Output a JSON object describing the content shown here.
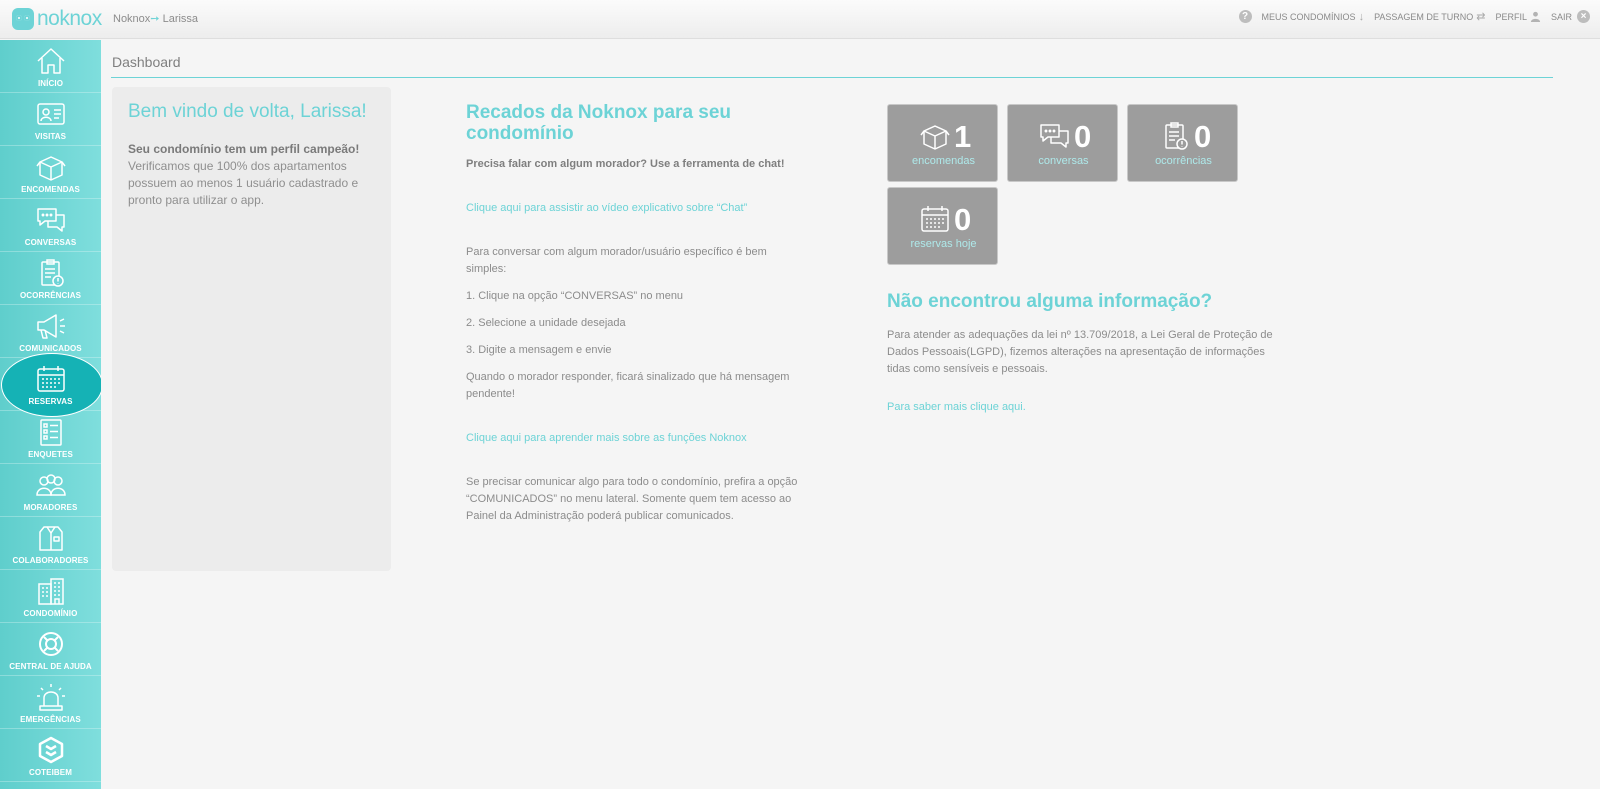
{
  "app": {
    "logo_text": "noknox"
  },
  "breadcrumb": {
    "root": "Noknox",
    "arrow": "➙",
    "current": "Larissa"
  },
  "topnav": {
    "help_icon": "question-circle-icon",
    "meus_condominios": "MEUS CONDOMÍNIOS",
    "passagem_de_turno": "PASSAGEM DE TURNO",
    "perfil": "PERFIL",
    "sair": "SAIR"
  },
  "sidebar": {
    "items": [
      {
        "label": "INÍCIO",
        "icon": "home-icon"
      },
      {
        "label": "VISITAS",
        "icon": "id-card-icon"
      },
      {
        "label": "ENCOMENDAS",
        "icon": "package-icon"
      },
      {
        "label": "CONVERSAS",
        "icon": "chat-icon"
      },
      {
        "label": "OCORRÊNCIAS",
        "icon": "clipboard-alert-icon"
      },
      {
        "label": "COMUNICADOS",
        "icon": "megaphone-icon"
      },
      {
        "label": "RESERVAS",
        "icon": "calendar-icon",
        "active": true
      },
      {
        "label": "ENQUETES",
        "icon": "checklist-icon"
      },
      {
        "label": "MORADORES",
        "icon": "residents-icon"
      },
      {
        "label": "COLABORADORES",
        "icon": "staff-icon"
      },
      {
        "label": "CONDOMÍNIO",
        "icon": "building-icon"
      },
      {
        "label": "CENTRAL DE AJUDA",
        "icon": "lifebuoy-icon"
      },
      {
        "label": "EMERGÊNCIAS",
        "icon": "siren-icon"
      },
      {
        "label": "COTEIBEM",
        "icon": "coteibem-icon"
      }
    ]
  },
  "main": {
    "page_title": "Dashboard",
    "welcome": {
      "title": "Bem vindo de volta, Larissa!",
      "subtitle": "Seu condomínio tem um perfil campeão!",
      "body": "Verificamos que 100% dos apartamentos possuem ao menos 1 usuário cadastrado e pronto para utilizar o app."
    },
    "messages": {
      "title": "Recados da Noknox para seu condomínio",
      "intro": "Precisa falar com algum morador? Use a ferramenta de chat!",
      "video_link": "Clique aqui para assistir ao vídeo explicativo sobre “Chat”",
      "para1": "Para conversar com algum morador/usuário específico é bem simples:",
      "step1": "1. Clique na opção “CONVERSAS” no menu",
      "step2": "2. Selecione a unidade desejada",
      "step3": "3. Digite a mensagem e envie",
      "para2": "Quando o morador responder, ficará sinalizado que há mensagem pendente!",
      "learn_link": "Clique aqui para aprender mais sobre as funções Noknox",
      "para3": "Se precisar comunicar algo para todo o condomínio, prefira a opção “COMUNICADOS” no menu lateral. Somente quem tem acesso ao Painel da Administração poderá publicar comunicados."
    },
    "stats": [
      {
        "value": "1",
        "label": "encomendas",
        "icon": "package-icon"
      },
      {
        "value": "0",
        "label": "conversas",
        "icon": "chat-icon"
      },
      {
        "value": "0",
        "label": "ocorrências",
        "icon": "clipboard-alert-icon"
      },
      {
        "value": "0",
        "label": "reservas hoje",
        "icon": "calendar-icon"
      }
    ],
    "info": {
      "title": "Não encontrou alguma informação?",
      "body": "Para atender as adequações da lei nº 13.709/2018, a Lei Geral de Proteção de Dados Pessoais(LGPD), fizemos alterações na apresentação de informações tidas como sensíveis e pessoais.",
      "link": "Para saber mais clique aqui."
    }
  },
  "colors": {
    "accent": "#6dd3d6",
    "sidebar_active": "#15b2b5",
    "stat_tile": "#9d9d9d",
    "welcome_panel": "#ececec",
    "background": "#f5f5f5"
  }
}
